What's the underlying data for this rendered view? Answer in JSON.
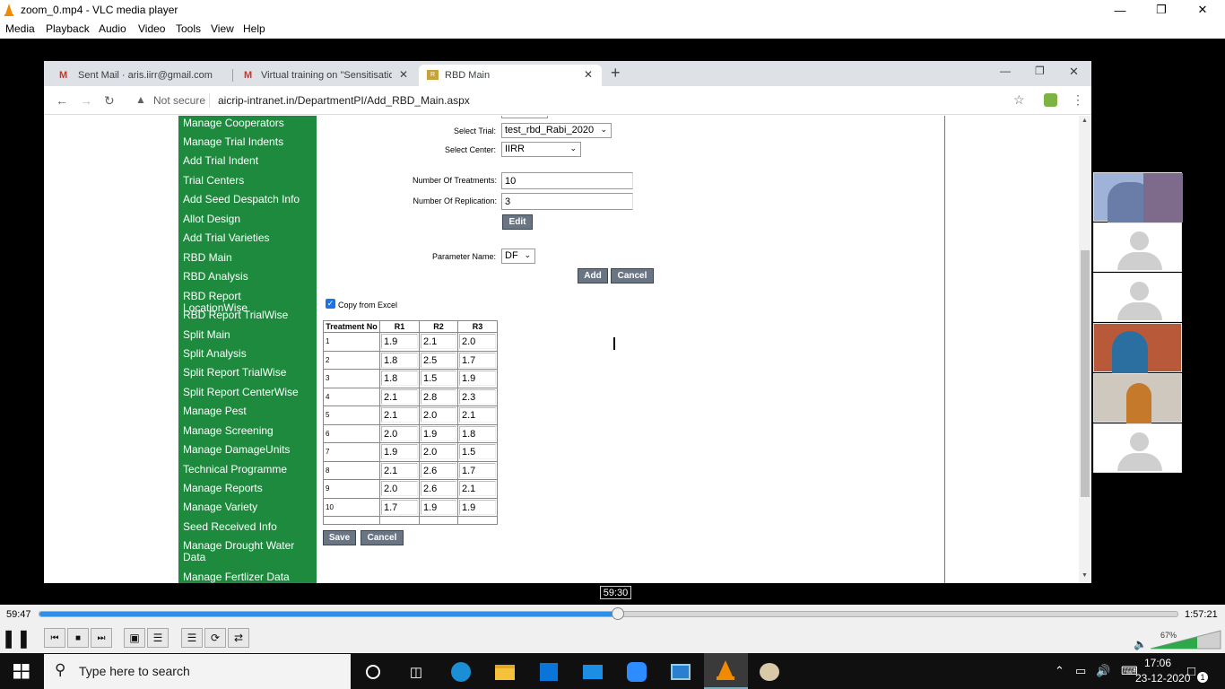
{
  "vlc": {
    "window_title": "zoom_0.mp4 - VLC media player",
    "menu": [
      "Media",
      "Playback",
      "Audio",
      "Video",
      "Tools",
      "View",
      "Help"
    ],
    "elapsed": "59:47",
    "total": "1:57:21",
    "seek_tooltip": "59:30",
    "progress_fraction": 0.508,
    "volume_percent": "67%"
  },
  "browser": {
    "tabs": [
      {
        "label": "Sent Mail · aris.iirr@gmail.com",
        "icon": "gmail-icon"
      },
      {
        "label": "Virtual training on \"Sensitisation",
        "icon": "gmail-icon"
      },
      {
        "label": "RBD Main",
        "icon": "site-icon"
      }
    ],
    "security_text": "Not secure",
    "url": "aicrip-intranet.in/DepartmentPI/Add_RBD_Main.aspx"
  },
  "sidebar": {
    "items": [
      "Manage Cooperators",
      "Manage Trial Indents",
      "Add Trial Indent",
      "Trial Centers",
      "Add Seed Despatch Info",
      "Allot Design",
      "Add Trial Varieties",
      "RBD Main",
      "RBD Analysis",
      "RBD Report LocationWise",
      "RBD Report TrialWise",
      "Split Main",
      "Split Analysis",
      "Split Report TrialWise",
      "Split Report CenterWise",
      "Manage Pest",
      "Manage Screening",
      "Manage DamageUnits",
      "Technical Programme",
      "Manage Reports",
      "Manage Variety",
      "Seed Received Info",
      "Manage Drought Water Data",
      "Manage Fertlizer Data"
    ]
  },
  "form": {
    "select_trial_label": "Select Trial:",
    "select_trial_value": "test_rbd_Rabi_2020",
    "select_center_label": "Select Center:",
    "select_center_value": "IIRR",
    "treatments_label": "Number Of Treatments:",
    "treatments_value": "10",
    "replication_label": "Number Of Replication:",
    "replication_value": "3",
    "edit_label": "Edit",
    "parameter_label": "Parameter Name:",
    "parameter_value": "DF",
    "add_label": "Add",
    "cancel_label": "Cancel",
    "copy_excel_label": "Copy from Excel",
    "save_label": "Save",
    "cancel2_label": "Cancel"
  },
  "grid": {
    "headers": [
      "Treatment No",
      "R1",
      "R2",
      "R3"
    ],
    "rows": [
      [
        "1",
        "1.9",
        "2.1",
        "2.0"
      ],
      [
        "2",
        "1.8",
        "2.5",
        "1.7"
      ],
      [
        "3",
        "1.8",
        "1.5",
        "1.9"
      ],
      [
        "4",
        "2.1",
        "2.8",
        "2.3"
      ],
      [
        "5",
        "2.1",
        "2.0",
        "2.1"
      ],
      [
        "6",
        "2.0",
        "1.9",
        "1.8"
      ],
      [
        "7",
        "1.9",
        "2.0",
        "1.5"
      ],
      [
        "8",
        "2.1",
        "2.6",
        "1.7"
      ],
      [
        "9",
        "2.0",
        "2.6",
        "2.1"
      ],
      [
        "10",
        "1.7",
        "1.9",
        "1.9"
      ]
    ]
  },
  "taskbar": {
    "search_placeholder": "Type here to search",
    "time": "17:06",
    "date": "23-12-2020",
    "notification_count": "1"
  }
}
